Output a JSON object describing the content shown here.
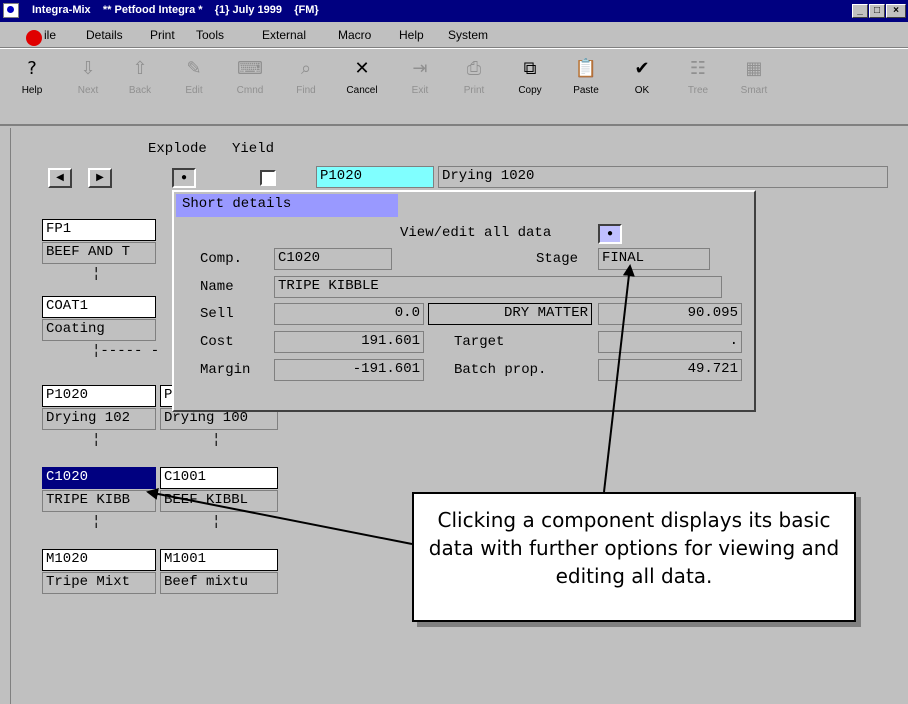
{
  "window": {
    "title": "Integra-Mix    ** Petfood Integra *    {1} July 1999    {FM}",
    "controls": [
      "_",
      "□",
      "×"
    ]
  },
  "menu": [
    {
      "label": "File",
      "display": "ile"
    },
    {
      "label": "Details"
    },
    {
      "label": "Print"
    },
    {
      "label": "Tools"
    },
    {
      "label": "External"
    },
    {
      "label": "Macro"
    },
    {
      "label": "Help"
    },
    {
      "label": "System"
    }
  ],
  "toolbar": [
    {
      "label": "Help",
      "icon": "help-icon",
      "glyph": "?",
      "enabled": true
    },
    {
      "label": "Next",
      "icon": "down-arrow-icon",
      "glyph": "⇩",
      "enabled": false
    },
    {
      "label": "Back",
      "icon": "up-arrow-icon",
      "glyph": "⇧",
      "enabled": false
    },
    {
      "label": "Edit",
      "icon": "edit-icon",
      "glyph": "✎",
      "enabled": false
    },
    {
      "label": "Cmnd",
      "icon": "keyboard-icon",
      "glyph": "⌨",
      "enabled": false
    },
    {
      "label": "Find",
      "icon": "find-icon",
      "glyph": "⌕",
      "enabled": false
    },
    {
      "label": "Cancel",
      "icon": "cancel-icon",
      "glyph": "✕",
      "enabled": true
    },
    {
      "label": "Exit",
      "icon": "exit-icon",
      "glyph": "⇥",
      "enabled": false
    },
    {
      "label": "Print",
      "icon": "printer-icon",
      "glyph": "⎙",
      "enabled": false
    },
    {
      "label": "Copy",
      "icon": "copy-icon",
      "glyph": "⧉",
      "enabled": true
    },
    {
      "label": "Paste",
      "icon": "paste-icon",
      "glyph": "📋",
      "enabled": true
    },
    {
      "label": "OK",
      "icon": "checkmark-icon",
      "glyph": "✔",
      "enabled": true
    },
    {
      "label": "Tree",
      "icon": "tree-icon",
      "glyph": "☷",
      "enabled": false
    },
    {
      "label": "Smart",
      "icon": "smart-icon",
      "glyph": "▦",
      "enabled": false
    }
  ],
  "header": {
    "explode_label": "Explode",
    "yield_label": "Yield",
    "code": "P1020",
    "description": "Drying 1020"
  },
  "tree": {
    "level1": {
      "code": "FP1",
      "desc": "BEEF AND T"
    },
    "level2": {
      "code": "COAT1",
      "desc": "Coating"
    },
    "branch": "¦----- -",
    "level3": [
      {
        "code": "P1020",
        "desc": "Drying 102"
      },
      {
        "code": "P",
        "desc": "Drying 100"
      }
    ],
    "level4": [
      {
        "code": "C1020",
        "desc": "TRIPE KIBB",
        "selected": true
      },
      {
        "code": "C1001",
        "desc": "BEEF KIBBL",
        "selected": false
      }
    ],
    "level5": [
      {
        "code": "M1020",
        "desc": "Tripe Mixt"
      },
      {
        "code": "M1001",
        "desc": "Beef mixtu"
      }
    ],
    "tick": "¦"
  },
  "short_details": {
    "title": "Short details",
    "view_edit_label": "View/edit all data",
    "comp_label": "Comp.",
    "comp_value": "C1020",
    "stage_label": "Stage",
    "stage_value": "FINAL",
    "name_label": "Name",
    "name_value": "TRIPE KIBBLE",
    "sell_label": "Sell",
    "sell_value": "0.0",
    "cost_label": "Cost",
    "cost_value": "191.601",
    "margin_label": "Margin",
    "margin_value": "-191.601",
    "nutrient_label": "DRY MATTER",
    "nutrient_value": "90.095",
    "target_label": "Target",
    "target_value": ".",
    "batch_label": "Batch prop.",
    "batch_value": "49.721"
  },
  "callout": {
    "text": "Clicking a component displays its basic data with further options for viewing and editing all data."
  }
}
